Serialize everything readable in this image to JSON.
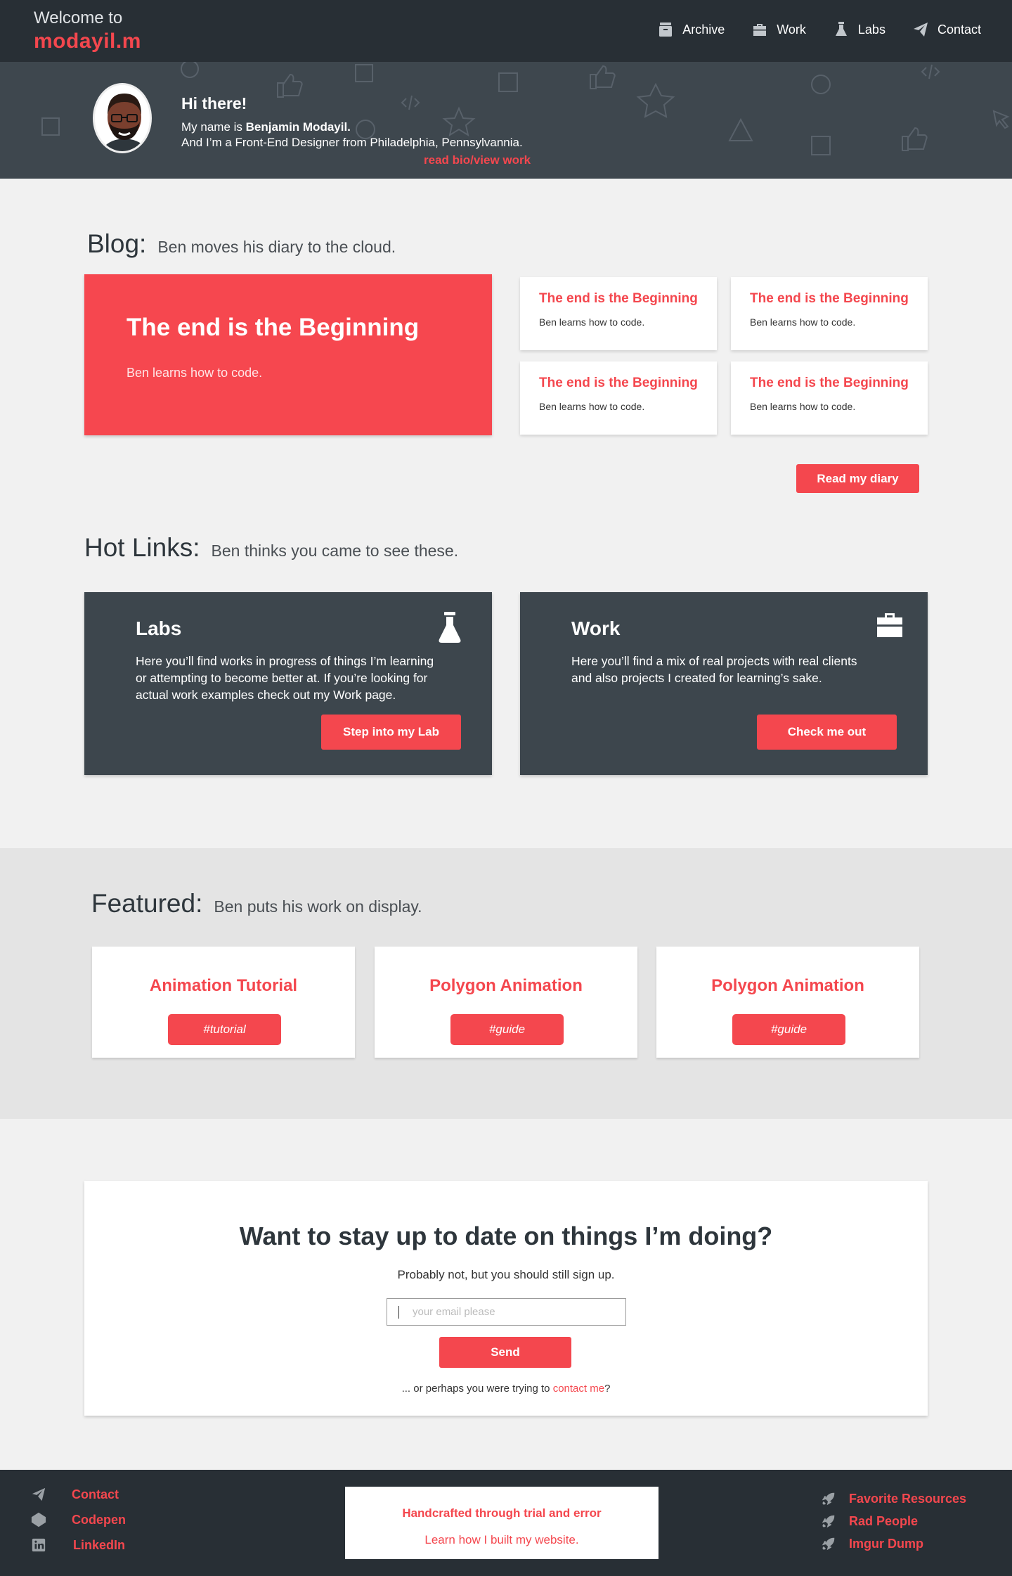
{
  "header": {
    "welcome": "Welcome to",
    "logo": "modayil.m",
    "nav": [
      {
        "label": "Archive",
        "icon": "archive-icon"
      },
      {
        "label": "Work",
        "icon": "briefcase-icon"
      },
      {
        "label": "Labs",
        "icon": "flask-icon"
      },
      {
        "label": "Contact",
        "icon": "paper-plane-icon"
      }
    ]
  },
  "hero": {
    "greeting": "Hi there!",
    "name_prefix": "My name is",
    "name": "Benjamin Modayil.",
    "role_line": "And I’m a  Front-End Designer from Philadelphia, Pennsylvannia.",
    "link": "read bio/view work"
  },
  "blog": {
    "title": "Blog:",
    "subtitle": "Ben moves his diary to the cloud.",
    "feature": {
      "title": "The end is the Beginning",
      "summary": "Ben learns how to code."
    },
    "posts": [
      {
        "title": "The end is the Beginning",
        "summary": "Ben learns how to code."
      },
      {
        "title": "The end is the Beginning",
        "summary": "Ben learns how to code."
      },
      {
        "title": "The end is the Beginning",
        "summary": "Ben learns how to code."
      },
      {
        "title": "The end is the Beginning",
        "summary": "Ben learns how to code."
      }
    ],
    "button": "Read my diary"
  },
  "hotlinks": {
    "title": "Hot Links:",
    "subtitle": "Ben thinks you came to see these.",
    "cards": [
      {
        "title": "Labs",
        "description": "Here you’ll find works in progress of things I’m learning or attempting to become better at. If you’re looking for actual work examples check out my Work page.",
        "button": "Step into my Lab",
        "icon": "flask-icon"
      },
      {
        "title": "Work",
        "description": "Here you’ll find a mix of real projects with real clients and also projects I created for learning’s sake.",
        "button": "Check me out",
        "icon": "briefcase-icon"
      }
    ]
  },
  "featured": {
    "title": "Featured:",
    "subtitle": "Ben puts his work on display.",
    "items": [
      {
        "title": "Animation Tutorial",
        "tag": "#tutorial"
      },
      {
        "title": "Polygon Animation",
        "tag": "#guide"
      },
      {
        "title": "Polygon Animation",
        "tag": "#guide"
      }
    ]
  },
  "newsletter": {
    "heading": "Want to stay up to date on things I’m doing?",
    "subheading": "Probably not, but you should still sign up.",
    "placeholder": "your email please",
    "button": "Send",
    "alt_prefix": "... or perhaps you were trying to",
    "alt_link": "contact me",
    "alt_suffix": "?"
  },
  "footer": {
    "left_links": [
      {
        "label": "Contact",
        "icon": "paper-plane-icon"
      },
      {
        "label": "Codepen",
        "icon": "codepen-icon"
      },
      {
        "label": "LinkedIn",
        "icon": "linkedin-icon"
      }
    ],
    "tagline": "Handcrafted through trial and error",
    "build_link": "Learn how I built my website.",
    "right_links": [
      {
        "label": "Favorite Resources",
        "icon": "rocket-icon"
      },
      {
        "label": "Rad People",
        "icon": "rocket-icon"
      },
      {
        "label": "Imgur Dump",
        "icon": "rocket-icon"
      }
    ]
  },
  "colors": {
    "accent": "#f4474e",
    "dark": "#282f35",
    "slate": "#3d464d",
    "background": "#f1f1f1"
  }
}
